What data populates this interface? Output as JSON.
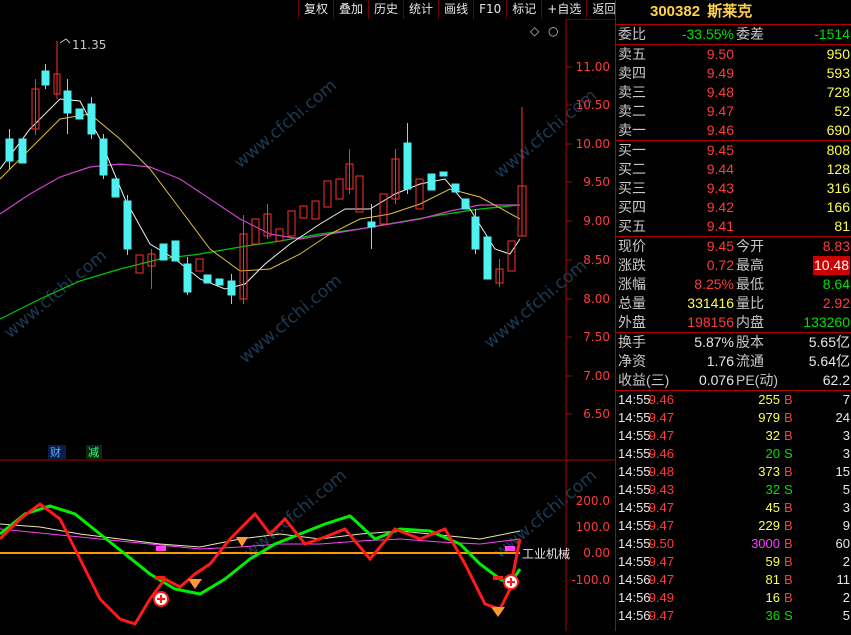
{
  "toolbar": {
    "buttons": [
      "复权",
      "叠加",
      "历史",
      "统计",
      "画线",
      "F10",
      "标记",
      "+自选",
      "返回"
    ]
  },
  "chart": {
    "price_axis": [
      "11.00",
      "10.50",
      "10.00",
      "9.50",
      "9.00",
      "8.50",
      "8.00",
      "7.50",
      "7.00",
      "6.50"
    ],
    "high_label": "11.35",
    "tag_cai": "财",
    "tag_jian": "减",
    "indicator_axis": [
      "200.0",
      "100.0",
      "0.00",
      "-100.0"
    ],
    "sector_label": "工业机械",
    "watermark": "www.cfchi.com",
    "diamond_icon": "◇"
  },
  "quote": {
    "code": "300382",
    "name": "斯莱克",
    "weibi_label": "委比",
    "weibi": "-33.55%",
    "weicha_label": "委差",
    "weicha": "-1514",
    "sells": [
      {
        "label": "卖五",
        "price": "9.50",
        "vol": "950"
      },
      {
        "label": "卖四",
        "price": "9.49",
        "vol": "593"
      },
      {
        "label": "卖三",
        "price": "9.48",
        "vol": "728"
      },
      {
        "label": "卖二",
        "price": "9.47",
        "vol": "52"
      },
      {
        "label": "卖一",
        "price": "9.46",
        "vol": "690"
      }
    ],
    "buys": [
      {
        "label": "买一",
        "price": "9.45",
        "vol": "808"
      },
      {
        "label": "买二",
        "price": "9.44",
        "vol": "128"
      },
      {
        "label": "买三",
        "price": "9.43",
        "vol": "316"
      },
      {
        "label": "买四",
        "price": "9.42",
        "vol": "166"
      },
      {
        "label": "买五",
        "price": "9.41",
        "vol": "81"
      }
    ],
    "stats": [
      {
        "l1": "现价",
        "v1": "9.45",
        "l2": "今开",
        "v2": "8.83"
      },
      {
        "l1": "涨跌",
        "v1": "0.72",
        "l2": "最高",
        "v2": "10.48"
      },
      {
        "l1": "涨幅",
        "v1": "8.25%",
        "l2": "最低",
        "v2": "8.64"
      },
      {
        "l1": "总量",
        "v1": "331416",
        "l2": "量比",
        "v2": "2.92"
      },
      {
        "l1": "外盘",
        "v1": "198156",
        "l2": "内盘",
        "v2": "133260"
      }
    ],
    "finance": [
      {
        "l1": "换手",
        "v1": "5.87%",
        "l2": "股本",
        "v2": "5.65亿"
      },
      {
        "l1": "净资",
        "v1": "1.76",
        "l2": "流通",
        "v2": "5.64亿"
      },
      {
        "l1": "收益(三)",
        "v1": "0.076",
        "l2": "PE(动)",
        "v2": "62.2"
      }
    ],
    "ticks": [
      {
        "time": "14:55",
        "price": "9.46",
        "vol": "255",
        "side": "B",
        "n": "7"
      },
      {
        "time": "14:55",
        "price": "9.47",
        "vol": "979",
        "side": "B",
        "n": "24"
      },
      {
        "time": "14:55",
        "price": "9.47",
        "vol": "32",
        "side": "B",
        "n": "3"
      },
      {
        "time": "14:55",
        "price": "9.46",
        "vol": "20",
        "side": "S",
        "n": "3"
      },
      {
        "time": "14:55",
        "price": "9.48",
        "vol": "373",
        "side": "B",
        "n": "15"
      },
      {
        "time": "14:55",
        "price": "9.43",
        "vol": "32",
        "side": "S",
        "n": "5"
      },
      {
        "time": "14:55",
        "price": "9.47",
        "vol": "45",
        "side": "B",
        "n": "3"
      },
      {
        "time": "14:55",
        "price": "9.47",
        "vol": "229",
        "side": "B",
        "n": "9"
      },
      {
        "time": "14:55",
        "price": "9.50",
        "vol": "3000",
        "side": "B",
        "n": "60"
      },
      {
        "time": "14:55",
        "price": "9.47",
        "vol": "59",
        "side": "B",
        "n": "2"
      },
      {
        "time": "14:56",
        "price": "9.47",
        "vol": "81",
        "side": "B",
        "n": "11"
      },
      {
        "time": "14:56",
        "price": "9.49",
        "vol": "16",
        "side": "B",
        "n": "2"
      },
      {
        "time": "14:56",
        "price": "9.47",
        "vol": "36",
        "side": "S",
        "n": "5"
      }
    ]
  }
}
